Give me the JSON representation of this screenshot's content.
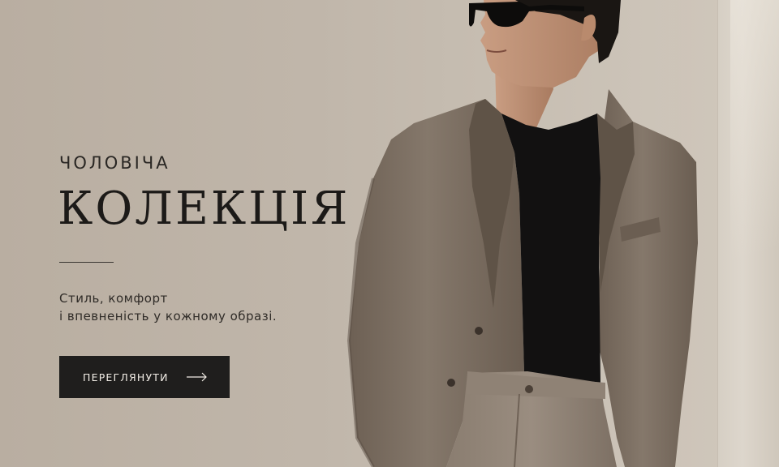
{
  "hero": {
    "subtitle": "ЧОЛОВІЧА",
    "title": "КОЛЕКЦІЯ",
    "tagline_line1": "Стиль, комфорт",
    "tagline_line2": "і впевненість у кожному образі.",
    "cta_label": "ПЕРЕГЛЯНУТИ",
    "cta_icon": "arrow-right-icon"
  },
  "colors": {
    "background": "#c0b6aa",
    "text_dark": "#1c1a18",
    "button_bg": "#1f1e1d",
    "button_text": "#f1ece5",
    "suit": "#7a6c5f",
    "shirt": "#121111"
  }
}
